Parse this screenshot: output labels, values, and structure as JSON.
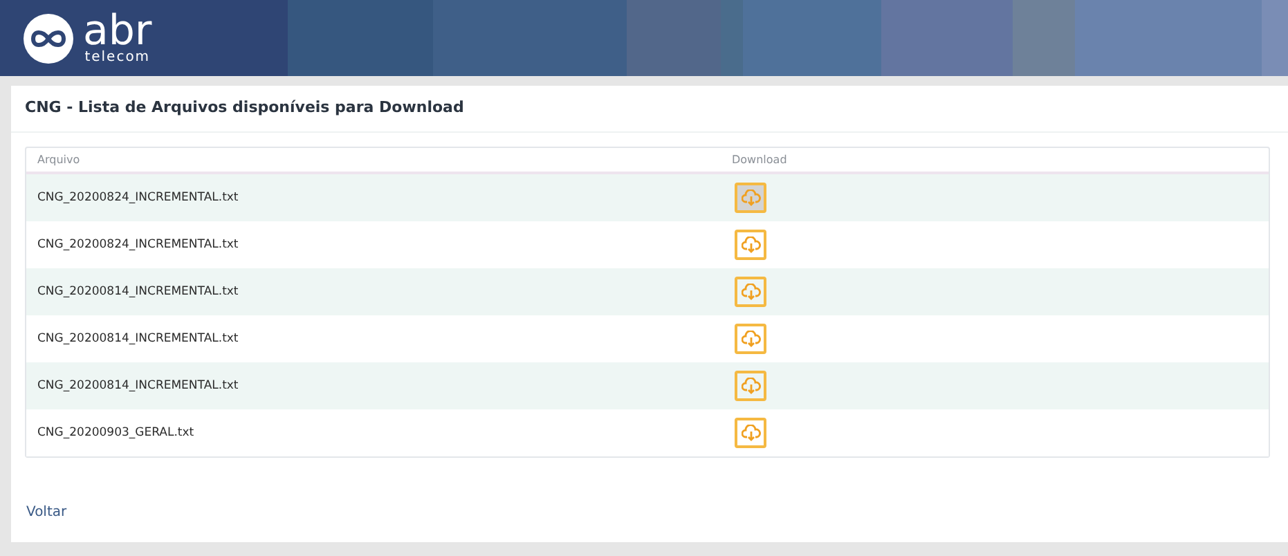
{
  "logo": {
    "brand": "abr",
    "tagline": "telecom"
  },
  "panel": {
    "title": "CNG - Lista de Arquivos disponíveis para Download"
  },
  "table": {
    "columns": [
      "Arquivo",
      "Download"
    ],
    "rows": [
      {
        "file": "CNG_20200824_INCREMENTAL.txt",
        "hovered": true
      },
      {
        "file": "CNG_20200824_INCREMENTAL.txt",
        "hovered": false
      },
      {
        "file": "CNG_20200814_INCREMENTAL.txt",
        "hovered": false
      },
      {
        "file": "CNG_20200814_INCREMENTAL.txt",
        "hovered": false
      },
      {
        "file": "CNG_20200814_INCREMENTAL.txt",
        "hovered": false
      },
      {
        "file": "CNG_20200903_GERAL.txt",
        "hovered": false
      }
    ]
  },
  "back_link": "Voltar"
}
